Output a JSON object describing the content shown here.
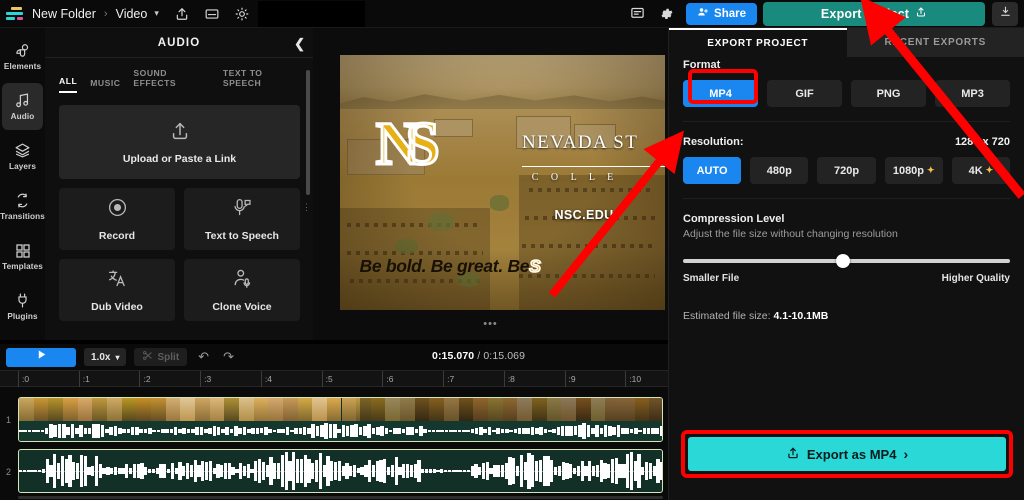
{
  "topbar": {
    "logo_icon": "app-logo",
    "breadcrumb_folder": "New Folder",
    "breadcrumb_sep": "›",
    "breadcrumb_project": "Video",
    "chevron": "⌄",
    "icons": [
      "share-upload-icon",
      "subtitle-icon",
      "brightness-icon"
    ],
    "share_label": "Share",
    "share_icon": "add-person-icon",
    "export_label": "Export Project",
    "export_icon": "upload-box-icon",
    "download_icon": "download-icon"
  },
  "rail": {
    "items": [
      {
        "label": "Elements",
        "icon": "elements-icon",
        "active": false
      },
      {
        "label": "Audio",
        "icon": "music-note-icon",
        "active": true
      },
      {
        "label": "Layers",
        "icon": "layers-icon",
        "active": false
      },
      {
        "label": "Transitions",
        "icon": "transitions-icon",
        "active": false
      },
      {
        "label": "Templates",
        "icon": "templates-grid-icon",
        "active": false
      },
      {
        "label": "Plugins",
        "icon": "plugin-icon",
        "active": false
      }
    ]
  },
  "audio_panel": {
    "title": "AUDIO",
    "collapse_icon": "chevron-left-icon",
    "tabs": [
      {
        "label": "ALL",
        "active": true
      },
      {
        "label": "MUSIC",
        "active": false
      },
      {
        "label": "SOUND EFFECTS",
        "active": false
      },
      {
        "label": "TEXT TO SPEECH",
        "active": false
      }
    ],
    "upload_label": "Upload or Paste a Link",
    "upload_icon": "upload-arrow-icon",
    "actions": [
      {
        "label": "Record",
        "icon": "record-dot-icon"
      },
      {
        "label": "Text to Speech",
        "icon": "microphone-speech-icon"
      },
      {
        "label": "Dub Video",
        "icon": "translate-icon"
      },
      {
        "label": "Clone Voice",
        "icon": "person-mic-icon"
      }
    ]
  },
  "preview": {
    "video_title": "Nevada State College campus aerial",
    "overlay_logo": "NS",
    "overlay_name": "NEVADA ST",
    "overlay_sub": "C O L L E",
    "overlay_url": "NSC.EDU",
    "overlay_tagline": "Be bold. Be great. Be",
    "overlay_tagline_accent": "S",
    "more_dots": "•••"
  },
  "controls": {
    "play_icon": "play-icon",
    "speed_value": "1.0x",
    "speed_chevron": "⌄",
    "split_label": "Split",
    "split_icon": "scissors-icon",
    "undo_icon": "undo-icon",
    "redo_icon": "redo-icon",
    "current_time": "0:15.070",
    "separator": "/",
    "total_time": "0:15.069"
  },
  "ruler": {
    "ticks": [
      ":0",
      ":1",
      ":2",
      ":3",
      ":4",
      ":5",
      ":6",
      ":7",
      ":8",
      ":9",
      ":10"
    ]
  },
  "timeline": {
    "tracks": [
      {
        "number": "1",
        "type": "video-with-audio"
      },
      {
        "number": "2",
        "type": "audio"
      }
    ]
  },
  "export_panel": {
    "tabs": [
      {
        "label": "EXPORT PROJECT",
        "active": true
      },
      {
        "label": "RECENT EXPORTS",
        "active": false
      }
    ],
    "format_label": "Format",
    "formats": [
      {
        "label": "MP4",
        "selected": true
      },
      {
        "label": "GIF",
        "selected": false
      },
      {
        "label": "PNG",
        "selected": false
      },
      {
        "label": "MP3",
        "selected": false
      }
    ],
    "resolution_label": "Resolution:",
    "resolution_value": "1280 x 720",
    "resolutions": [
      {
        "label": "AUTO",
        "selected": true,
        "premium": false
      },
      {
        "label": "480p",
        "selected": false,
        "premium": false
      },
      {
        "label": "720p",
        "selected": false,
        "premium": false
      },
      {
        "label": "1080p",
        "selected": false,
        "premium": true
      },
      {
        "label": "4K",
        "selected": false,
        "premium": true
      }
    ],
    "compression_label": "Compression Level",
    "compression_sub": "Adjust the file size without changing resolution",
    "slider_left": "Smaller File",
    "slider_right": "Higher Quality",
    "slider_percent": 49,
    "estimate_prefix": "Estimated file size:",
    "estimate_value": "4.1-10.1MB",
    "export_button_label": "Export as MP4",
    "export_button_icon": "upload-box-icon",
    "export_button_chevron": "›"
  },
  "annotations": {
    "arrow_color": "#ff0000",
    "highlight_color": "#ff0000",
    "arrows": [
      {
        "name": "arrow-to-export-project"
      },
      {
        "name": "arrow-to-preview"
      }
    ]
  }
}
